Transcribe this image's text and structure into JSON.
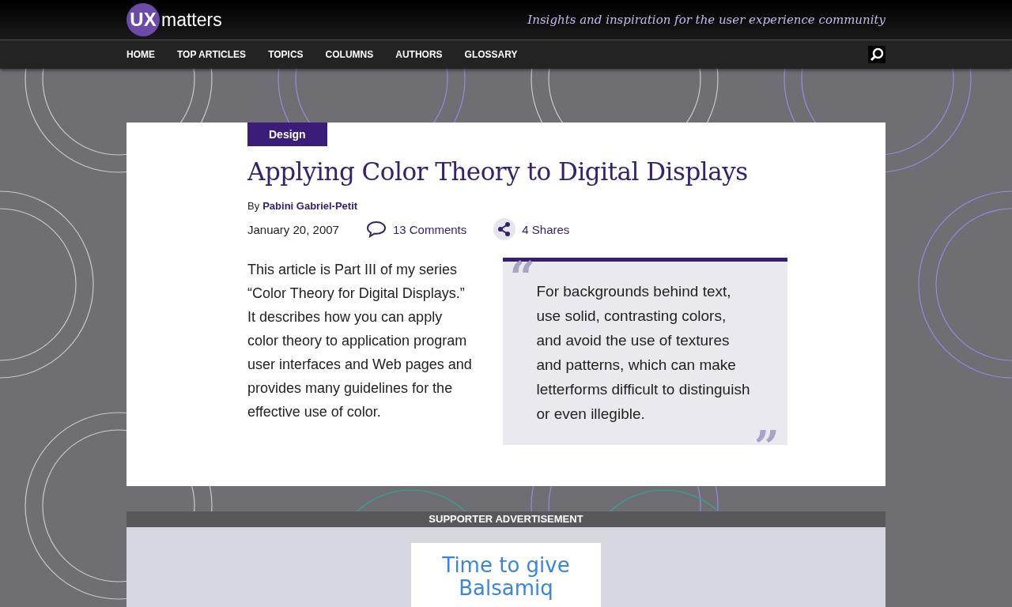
{
  "logo": {
    "mark": "UX",
    "word": "matters"
  },
  "tagline": "Insights and inspiration for the user experience community",
  "nav": [
    {
      "label": "HOME"
    },
    {
      "label": "TOP ARTICLES"
    },
    {
      "label": "TOPICS"
    },
    {
      "label": "COLUMNS"
    },
    {
      "label": "AUTHORS"
    },
    {
      "label": "GLOSSARY"
    }
  ],
  "article": {
    "category": "Design",
    "title": "Applying Color Theory to Digital Displays",
    "by": "By",
    "author": "Pabini Gabriel-Petit",
    "date": "January 20, 2007",
    "comments": "13 Comments",
    "shares": "4 Shares",
    "intro": "This article is Part III of my series “Color Theory for Digital Displays.” It describes how you can apply color theory to application program user interfaces and Web pages and provides many guidelines for the effective use of color.",
    "pullquote": {
      "open_mark": "“",
      "text": "For backgrounds behind text, use solid, contrasting colors, and avoid the use of textures and patterns, which can make letterforms difficult to distinguish or even illegible.",
      "close_mark": "”"
    }
  },
  "advertisement": {
    "label": "SUPPORTER ADVERTISEMENT",
    "ad_text": "Time to give Balsamiq"
  }
}
